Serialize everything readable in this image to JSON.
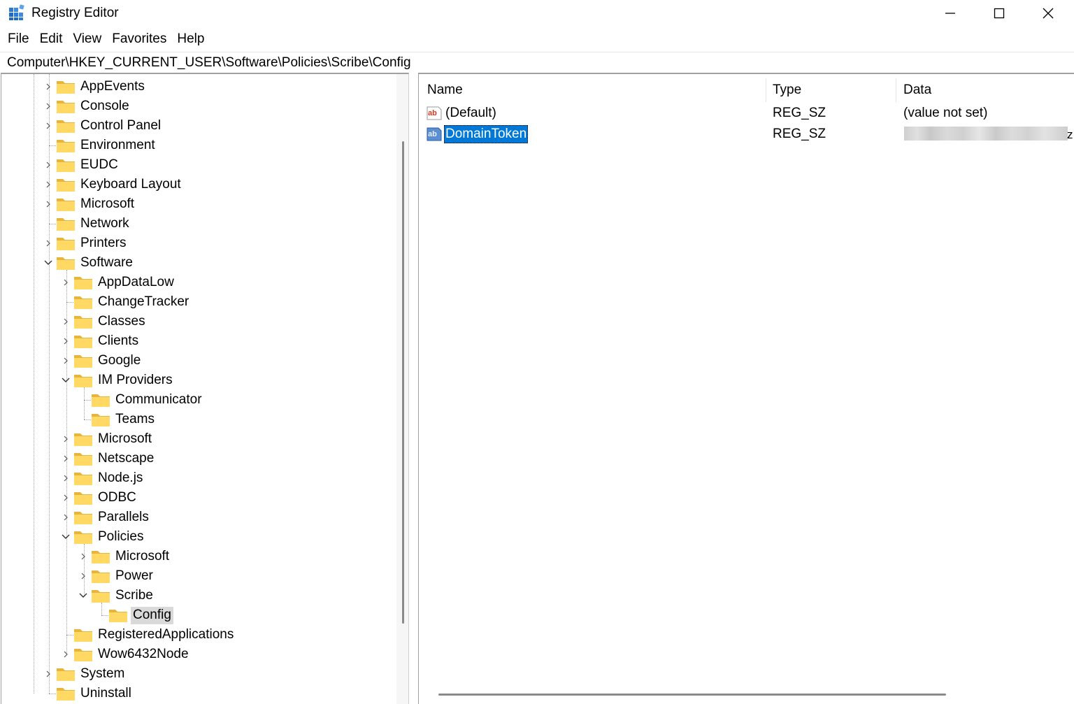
{
  "window": {
    "title": "Registry Editor",
    "accent": "#0078d7",
    "controls": {
      "minimize": "minimize-icon",
      "maximize": "maximize-icon",
      "close": "close-icon"
    }
  },
  "menu": [
    "File",
    "Edit",
    "View",
    "Favorites",
    "Help"
  ],
  "address": "Computer\\HKEY_CURRENT_USER\\Software\\Policies\\Scribe\\Config",
  "tree": [
    {
      "label": "AppEvents",
      "level": 1,
      "expander": "collapsed"
    },
    {
      "label": "Console",
      "level": 1,
      "expander": "collapsed"
    },
    {
      "label": "Control Panel",
      "level": 1,
      "expander": "collapsed"
    },
    {
      "label": "Environment",
      "level": 1,
      "expander": "none"
    },
    {
      "label": "EUDC",
      "level": 1,
      "expander": "collapsed"
    },
    {
      "label": "Keyboard Layout",
      "level": 1,
      "expander": "collapsed"
    },
    {
      "label": "Microsoft",
      "level": 1,
      "expander": "collapsed"
    },
    {
      "label": "Network",
      "level": 1,
      "expander": "none"
    },
    {
      "label": "Printers",
      "level": 1,
      "expander": "collapsed"
    },
    {
      "label": "Software",
      "level": 1,
      "expander": "expanded"
    },
    {
      "label": "AppDataLow",
      "level": 2,
      "expander": "collapsed"
    },
    {
      "label": "ChangeTracker",
      "level": 2,
      "expander": "none"
    },
    {
      "label": "Classes",
      "level": 2,
      "expander": "collapsed"
    },
    {
      "label": "Clients",
      "level": 2,
      "expander": "collapsed"
    },
    {
      "label": "Google",
      "level": 2,
      "expander": "collapsed"
    },
    {
      "label": "IM Providers",
      "level": 2,
      "expander": "expanded"
    },
    {
      "label": "Communicator",
      "level": 3,
      "expander": "none"
    },
    {
      "label": "Teams",
      "level": 3,
      "expander": "none"
    },
    {
      "label": "Microsoft",
      "level": 2,
      "expander": "collapsed"
    },
    {
      "label": "Netscape",
      "level": 2,
      "expander": "collapsed"
    },
    {
      "label": "Node.js",
      "level": 2,
      "expander": "collapsed"
    },
    {
      "label": "ODBC",
      "level": 2,
      "expander": "collapsed"
    },
    {
      "label": "Parallels",
      "level": 2,
      "expander": "collapsed"
    },
    {
      "label": "Policies",
      "level": 2,
      "expander": "expanded"
    },
    {
      "label": "Microsoft",
      "level": 3,
      "expander": "collapsed"
    },
    {
      "label": "Power",
      "level": 3,
      "expander": "collapsed"
    },
    {
      "label": "Scribe",
      "level": 3,
      "expander": "expanded"
    },
    {
      "label": "Config",
      "level": 4,
      "expander": "none",
      "selected": true
    },
    {
      "label": "RegisteredApplications",
      "level": 2,
      "expander": "none"
    },
    {
      "label": "Wow6432Node",
      "level": 2,
      "expander": "collapsed"
    },
    {
      "label": "System",
      "level": 1,
      "expander": "collapsed"
    },
    {
      "label": "Uninstall",
      "level": 1,
      "expander": "none"
    }
  ],
  "columns": {
    "name": "Name",
    "type": "Type",
    "data": "Data"
  },
  "values": [
    {
      "name": "(Default)",
      "type": "REG_SZ",
      "data": "(value not set)",
      "icon": "string-value-icon",
      "selected": false,
      "redacted": false
    },
    {
      "name": "DomainToken",
      "type": "REG_SZ",
      "data": "z",
      "icon": "string-value-icon",
      "selected": true,
      "redacted": true
    }
  ]
}
